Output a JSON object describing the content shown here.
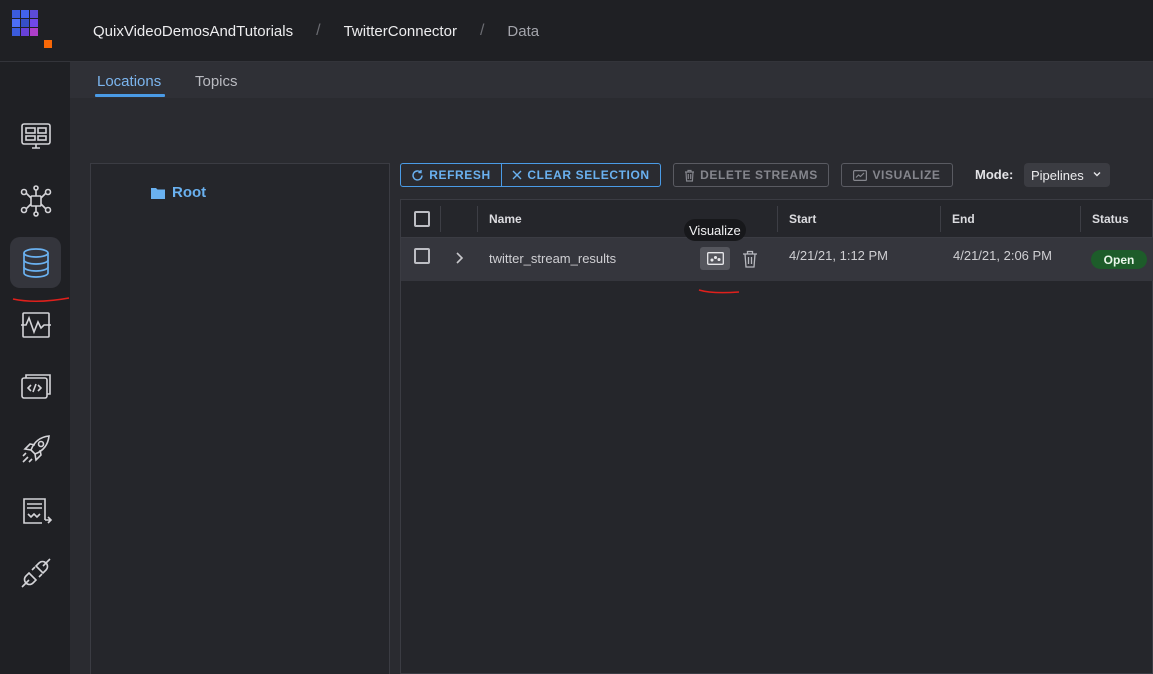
{
  "breadcrumb": {
    "workspace": "QuixVideoDemosAndTutorials",
    "project": "TwitterConnector",
    "section": "Data",
    "separator": "/"
  },
  "tabs": [
    {
      "label": "Locations",
      "active": true
    },
    {
      "label": "Topics",
      "active": false
    }
  ],
  "sidebar": {
    "items": [
      {
        "icon": "dashboard-icon",
        "active": false
      },
      {
        "icon": "pipeline-icon",
        "active": false
      },
      {
        "icon": "database-icon",
        "active": true
      },
      {
        "icon": "waveform-icon",
        "active": false
      },
      {
        "icon": "code-icon",
        "active": false
      },
      {
        "icon": "rocket-icon",
        "active": false
      },
      {
        "icon": "terminal-icon",
        "active": false
      },
      {
        "icon": "plug-icon",
        "active": false
      }
    ]
  },
  "tree": {
    "root_label": "Root"
  },
  "toolbar": {
    "refresh": "REFRESH",
    "clear_selection": "CLEAR SELECTION",
    "delete_streams": "DELETE STREAMS",
    "visualize": "VISUALIZE",
    "mode_label": "Mode:",
    "mode_value": "Pipelines"
  },
  "table": {
    "columns": [
      "Name",
      "Start",
      "End",
      "Status"
    ],
    "rows": [
      {
        "name": "twitter_stream_results",
        "start": "4/21/21, 1:12 PM",
        "end": "4/21/21, 2:06 PM",
        "status": "Open"
      }
    ]
  },
  "tooltip": "Visualize",
  "colors": {
    "accent": "#4a9be6",
    "status_open": "#1d5c2a",
    "annotation": "#e0201c"
  }
}
